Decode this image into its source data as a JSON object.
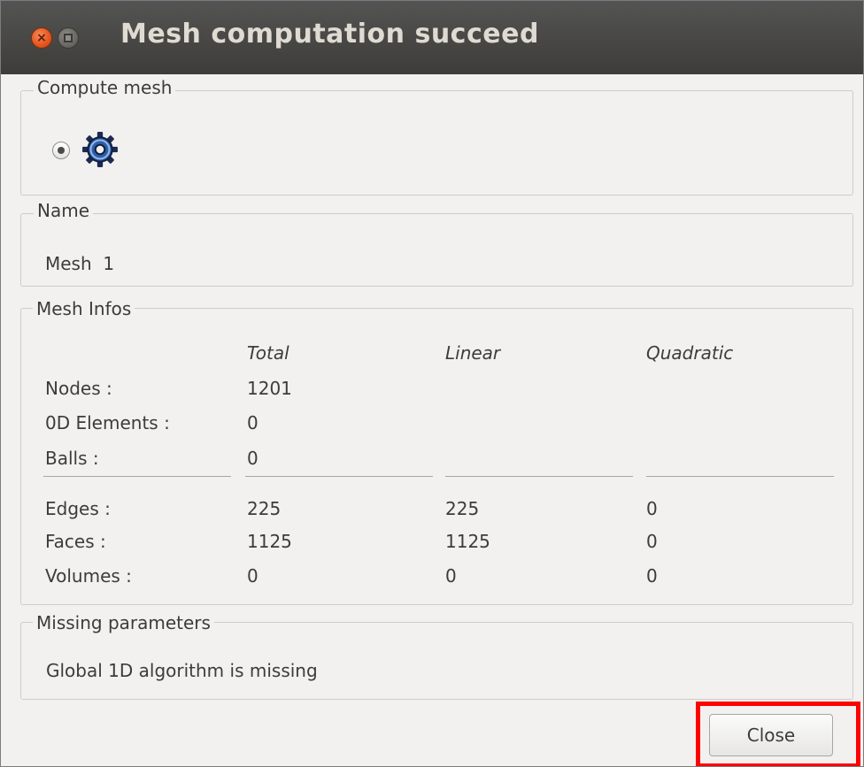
{
  "window": {
    "title": "Mesh computation succeed"
  },
  "compute_mesh": {
    "group_title": "Compute mesh",
    "icon": "gear-icon",
    "selected": true
  },
  "name_group": {
    "group_title": "Name",
    "value": "Mesh  1"
  },
  "mesh_infos": {
    "group_title": "Mesh Infos",
    "columns": [
      "Total",
      "Linear",
      "Quadratic"
    ],
    "rows": [
      {
        "label": "Nodes :",
        "total": "1201",
        "linear": "",
        "quadratic": ""
      },
      {
        "label": "0D Elements :",
        "total": "0",
        "linear": "",
        "quadratic": ""
      },
      {
        "label": "Balls :",
        "total": "0",
        "linear": "",
        "quadratic": ""
      },
      {
        "label": "Edges :",
        "total": "225",
        "linear": "225",
        "quadratic": "0"
      },
      {
        "label": "Faces :",
        "total": "1125",
        "linear": "1125",
        "quadratic": "0"
      },
      {
        "label": "Volumes :",
        "total": "0",
        "linear": "0",
        "quadratic": "0"
      }
    ]
  },
  "missing_parameters": {
    "group_title": "Missing parameters",
    "message": "Global 1D algorithm is missing"
  },
  "buttons": {
    "close_label": "Close"
  },
  "colors": {
    "titlebar": "#3d3c38",
    "dialog_bg": "#f2f1f0",
    "close_window_button": "#e4541e",
    "highlight": "#ff0000"
  }
}
